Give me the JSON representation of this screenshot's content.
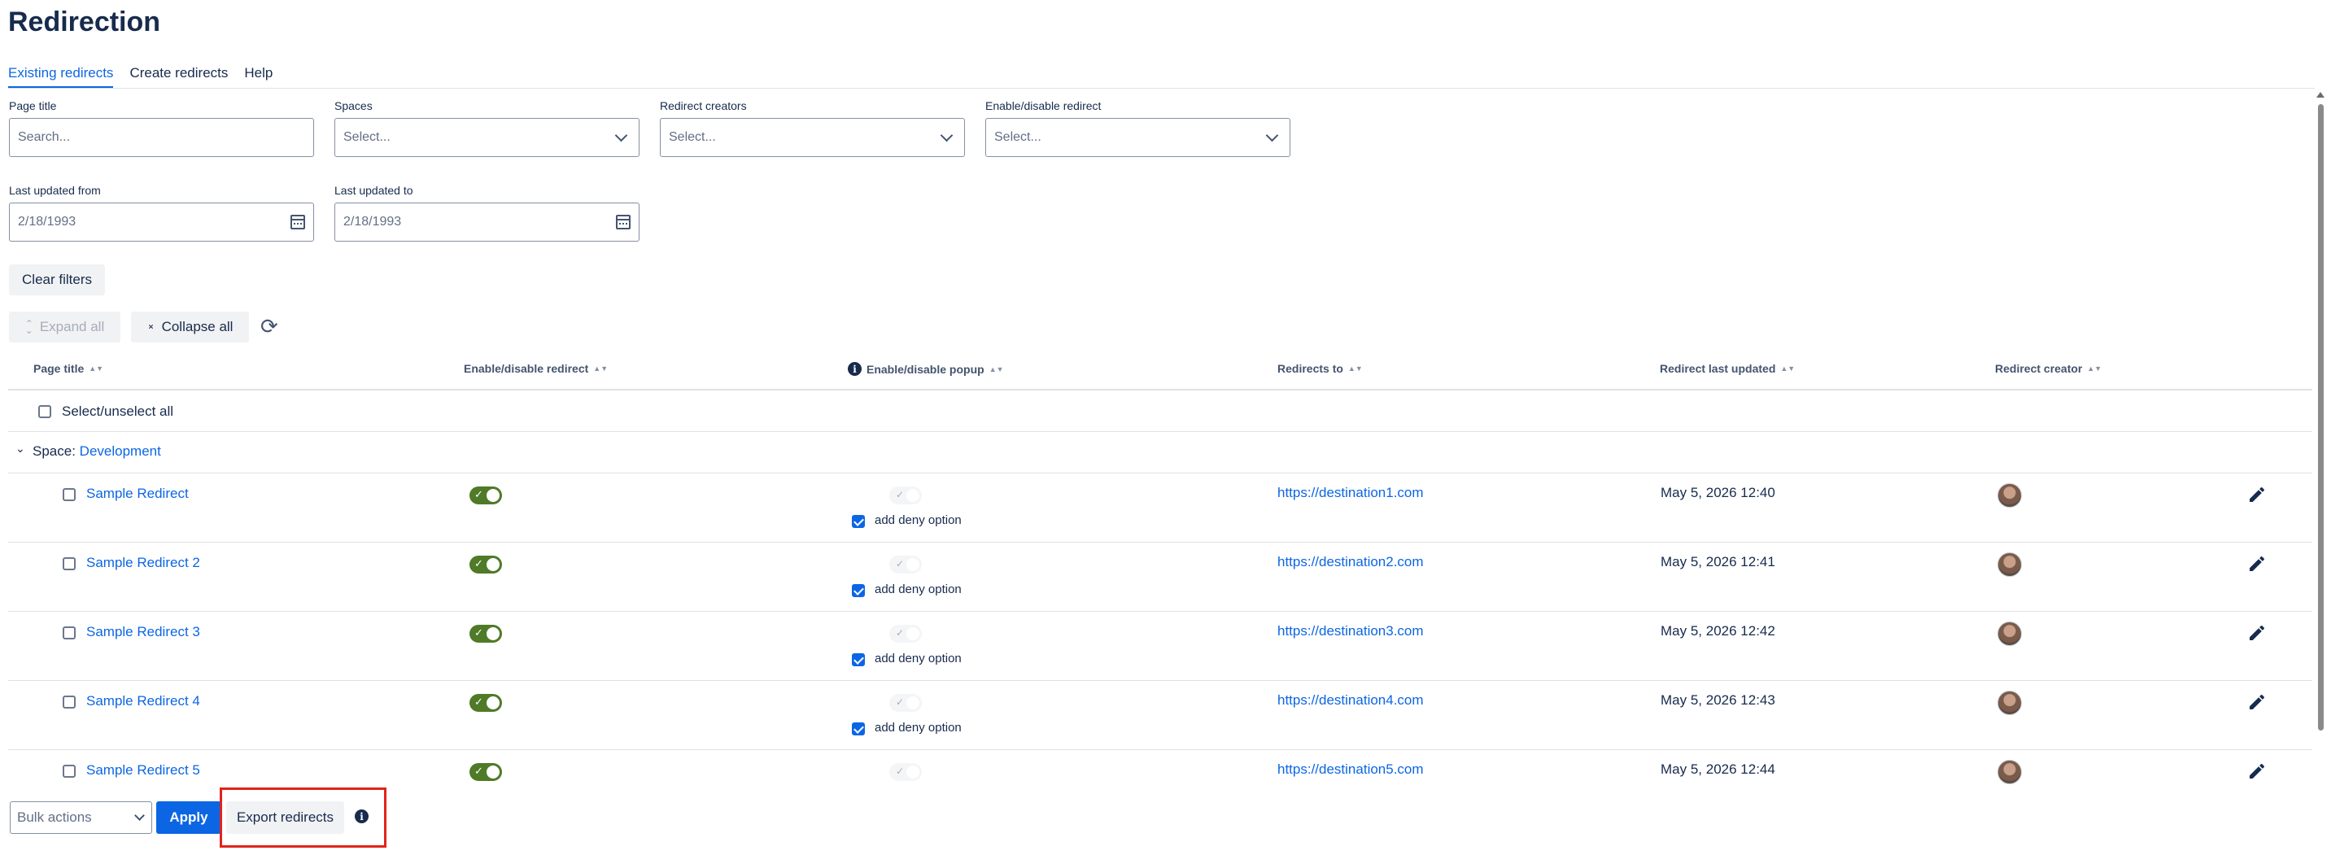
{
  "page": {
    "title": "Redirection"
  },
  "tabs": [
    {
      "label": "Existing redirects",
      "active": true
    },
    {
      "label": "Create redirects",
      "active": false
    },
    {
      "label": "Help",
      "active": false
    }
  ],
  "filters": {
    "page_title": {
      "label": "Page title",
      "placeholder": "Search..."
    },
    "spaces": {
      "label": "Spaces",
      "placeholder": "Select..."
    },
    "redirect_creators": {
      "label": "Redirect creators",
      "placeholder": "Select..."
    },
    "enable_disable": {
      "label": "Enable/disable redirect",
      "placeholder": "Select..."
    },
    "last_updated_from": {
      "label": "Last updated from",
      "value": "2/18/1993"
    },
    "last_updated_to": {
      "label": "Last updated to",
      "value": "2/18/1993"
    },
    "clear_label": "Clear filters"
  },
  "toolbar": {
    "expand_all": "Expand all",
    "collapse_all": "Collapse all"
  },
  "table": {
    "columns": [
      "Page title",
      "Enable/disable redirect",
      "Enable/disable popup",
      "Redirects to",
      "Redirect last updated",
      "Redirect creator"
    ],
    "select_all_label": "Select/unselect all",
    "space_group": {
      "prefix": "Space:",
      "name": "Development"
    },
    "rows": [
      {
        "title": "Sample Redirect",
        "redirect_enabled": true,
        "popup_enabled": false,
        "deny_label": "add deny option",
        "deny_checked": true,
        "destination": "https://destination1.com",
        "updated": "May 5, 2026 12:40"
      },
      {
        "title": "Sample Redirect 2",
        "redirect_enabled": true,
        "popup_enabled": false,
        "deny_label": "add deny option",
        "deny_checked": true,
        "destination": "https://destination2.com",
        "updated": "May 5, 2026 12:41"
      },
      {
        "title": "Sample Redirect 3",
        "redirect_enabled": true,
        "popup_enabled": false,
        "deny_label": "add deny option",
        "deny_checked": true,
        "destination": "https://destination3.com",
        "updated": "May 5, 2026 12:42"
      },
      {
        "title": "Sample Redirect 4",
        "redirect_enabled": true,
        "popup_enabled": false,
        "deny_label": "add deny option",
        "deny_checked": true,
        "destination": "https://destination4.com",
        "updated": "May 5, 2026 12:43"
      },
      {
        "title": "Sample Redirect 5",
        "redirect_enabled": true,
        "popup_enabled": false,
        "destination": "https://destination5.com",
        "updated": "May 5, 2026 12:44"
      }
    ]
  },
  "footer": {
    "bulk_actions": "Bulk actions",
    "apply": "Apply",
    "export": "Export redirects"
  },
  "colors": {
    "accent": "#0c66e4",
    "toggle_on": "#4f7a28",
    "highlight": "#e2231a"
  }
}
